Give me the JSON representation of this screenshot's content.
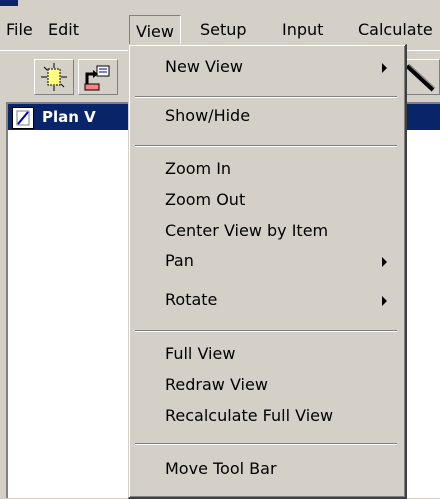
{
  "menubar": {
    "items": [
      {
        "label": "File"
      },
      {
        "label": "Edit"
      },
      {
        "label": "View"
      },
      {
        "label": "Setup"
      },
      {
        "label": "Input"
      },
      {
        "label": "Calculate"
      }
    ]
  },
  "document": {
    "title": "Plan V"
  },
  "view_menu": {
    "items": [
      {
        "label": "New View",
        "submenu": true
      },
      {
        "label": "Show/Hide"
      },
      {
        "label": "Zoom In"
      },
      {
        "label": "Zoom Out"
      },
      {
        "label": "Center View by Item"
      },
      {
        "label": "Pan",
        "submenu": true
      },
      {
        "label": "Rotate",
        "submenu": true
      },
      {
        "label": "Full View"
      },
      {
        "label": "Redraw View"
      },
      {
        "label": "Recalculate Full View"
      },
      {
        "label": "Move Tool Bar"
      }
    ]
  },
  "icons": [
    "new-plan-icon",
    "export-icon",
    "line-tool-icon"
  ],
  "colors": {
    "face": "#d4d0c8",
    "title_bar": "#0a246a",
    "document": "#ffffff"
  }
}
